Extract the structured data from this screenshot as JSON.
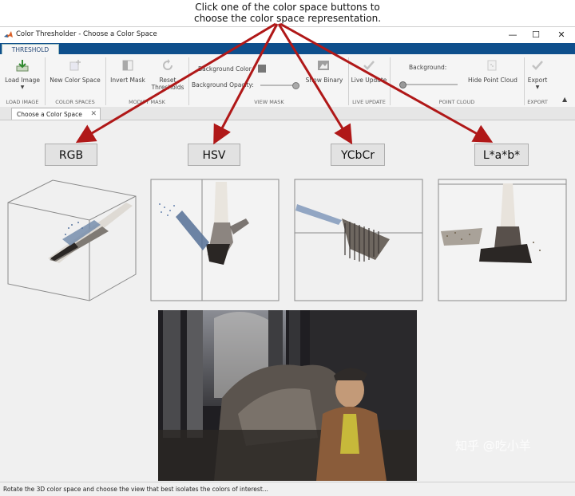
{
  "caption": {
    "line1": "Click one of the color space buttons to",
    "line2": "choose the color space representation."
  },
  "window": {
    "title": "Color Thresholder - Choose a Color Space",
    "minimize": "—",
    "maximize": "☐",
    "close": "✕"
  },
  "ribbon": {
    "tab": "THRESHOLD",
    "load_image": "Load Image",
    "new_color_space": "New Color Space",
    "invert_mask": "Invert Mask",
    "reset_thresholds_1": "Reset",
    "reset_thresholds_2": "Thresholds",
    "background_color": "Background Color",
    "background_opacity": "Background Opacity:",
    "show_binary": "Show Binary",
    "live_update": "Live Update",
    "background": "Background:",
    "hide_point_cloud": "Hide Point Cloud",
    "export": "Export",
    "sections": {
      "load_image": "LOAD IMAGE",
      "color_spaces": "COLOR SPACES",
      "modify_mask": "MODIFY MASK",
      "view_mask": "VIEW MASK",
      "live_update": "LIVE UPDATE",
      "point_cloud": "POINT CLOUD",
      "export": "EXPORT"
    }
  },
  "doc_tab": {
    "label": "Choose a Color Space",
    "close": "✕"
  },
  "color_spaces": [
    "RGB",
    "HSV",
    "YCbCr",
    "L*a*b*"
  ],
  "status": "Rotate the 3D color space and choose the view that best isolates the colors of interest...",
  "watermark": "知乎 @吃小羊",
  "colors": {
    "arrow": "#b01818",
    "ribbon_bar": "#0e4f8c"
  }
}
